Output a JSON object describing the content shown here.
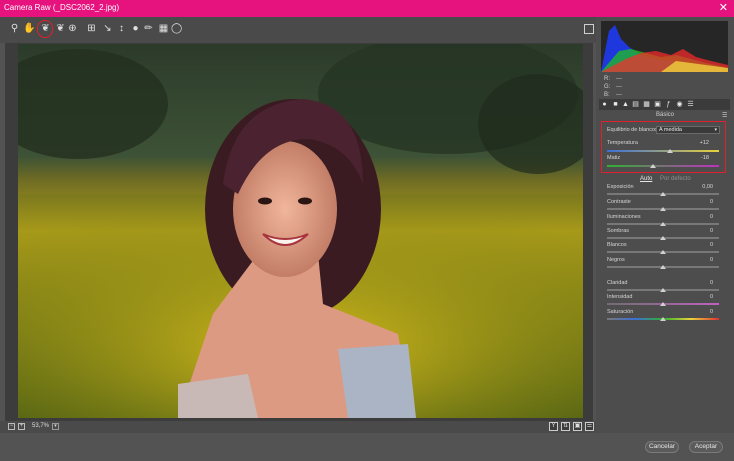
{
  "window": {
    "title": "Camera Raw (_DSC2062_2.jpg)"
  },
  "toolbar": {
    "tools": [
      "zoom-tool",
      "hand-tool",
      "white-balance-tool",
      "color-sampler-tool",
      "targeted-adjustment-tool",
      "crop-tool",
      "straighten-tool",
      "spot-removal-tool",
      "red-eye-tool",
      "adjustment-brush",
      "graduated-filter",
      "radial-filter"
    ],
    "active_tool": "white-balance-tool"
  },
  "statusbar": {
    "zoom": "53,7%"
  },
  "histogram": {
    "r_label": "R:",
    "g_label": "G:",
    "b_label": "B:",
    "dash": "---"
  },
  "panel": {
    "section_title": "Básico",
    "white_balance": {
      "label": "Equilibrio de blancos:",
      "value": "A medida"
    },
    "temperature": {
      "label": "Temperatura",
      "value": "+12",
      "level": 0.56
    },
    "tint": {
      "label": "Matiz",
      "value": "-18",
      "level": 0.41
    },
    "auto_label": "Auto",
    "default_label": "Por defecto",
    "sliders": [
      {
        "label": "Exposición",
        "value": "0,00",
        "level": 0.5
      },
      {
        "label": "Contraste",
        "value": "0",
        "level": 0.5
      },
      {
        "label": "Iluminaciones",
        "value": "0",
        "level": 0.5
      },
      {
        "label": "Sombras",
        "value": "0",
        "level": 0.5
      },
      {
        "label": "Blancos",
        "value": "0",
        "level": 0.5
      },
      {
        "label": "Negros",
        "value": "0",
        "level": 0.5
      },
      {
        "label": "Claridad",
        "value": "0",
        "level": 0.5
      },
      {
        "label": "Intensidad",
        "value": "0",
        "level": 0.5
      },
      {
        "label": "Saturación",
        "value": "0",
        "level": 0.5
      }
    ]
  },
  "buttons": {
    "cancel": "Cancelar",
    "accept": "Aceptar"
  },
  "colors": {
    "title_bar": "#e6137f",
    "highlight_ring": "#e0202a",
    "link": "#6fa2d6"
  }
}
